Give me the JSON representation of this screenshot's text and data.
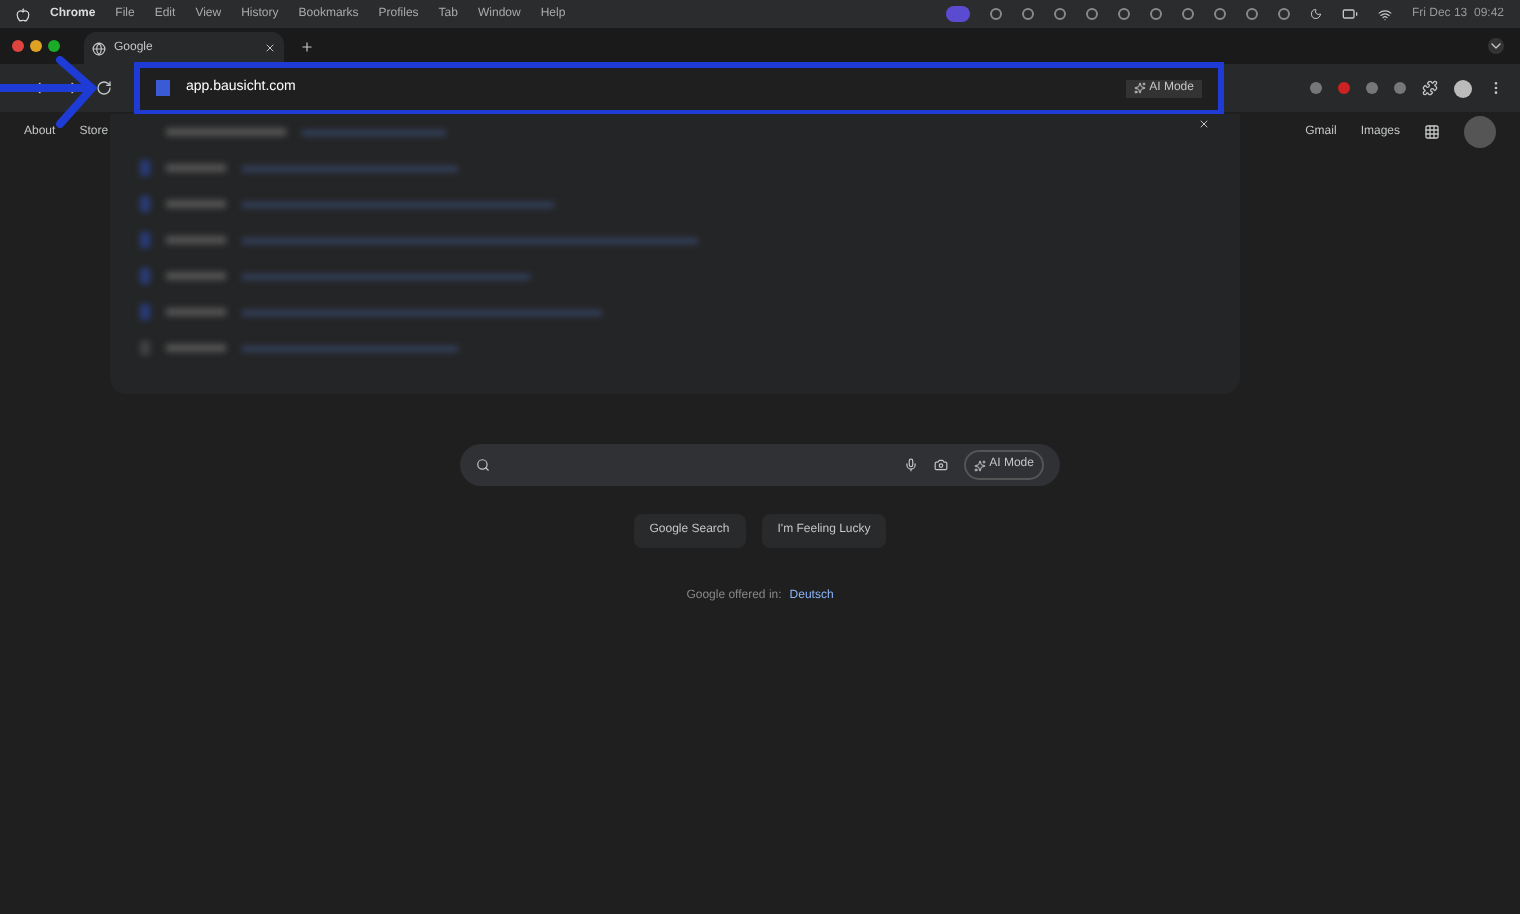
{
  "menu_bar": {
    "app": "Chrome",
    "items": [
      "File",
      "Edit",
      "View",
      "History",
      "Bookmarks",
      "Profiles",
      "Tab",
      "Window",
      "Help"
    ],
    "clock": "Fri Dec 13  09:42"
  },
  "tabs": [
    {
      "title": "Google",
      "selected": true
    }
  ],
  "address_bar": {
    "value": "app.bausicht.com",
    "ai_mode": "AI Mode",
    "highlighted": true
  },
  "suggestions": [
    {
      "kind": "header"
    },
    {
      "kind": "bookmark"
    },
    {
      "kind": "bookmark"
    },
    {
      "kind": "bookmark"
    },
    {
      "kind": "bookmark"
    },
    {
      "kind": "bookmark"
    },
    {
      "kind": "history"
    }
  ],
  "page": {
    "left_links": [
      "About",
      "Store"
    ],
    "right_links": [
      "Gmail",
      "Images"
    ],
    "search": {
      "ai_mode": "AI Mode"
    },
    "buttons": [
      "Google Search",
      "I'm Feeling Lucky"
    ],
    "offered_in": "Google offered in:",
    "language": "Deutsch"
  }
}
